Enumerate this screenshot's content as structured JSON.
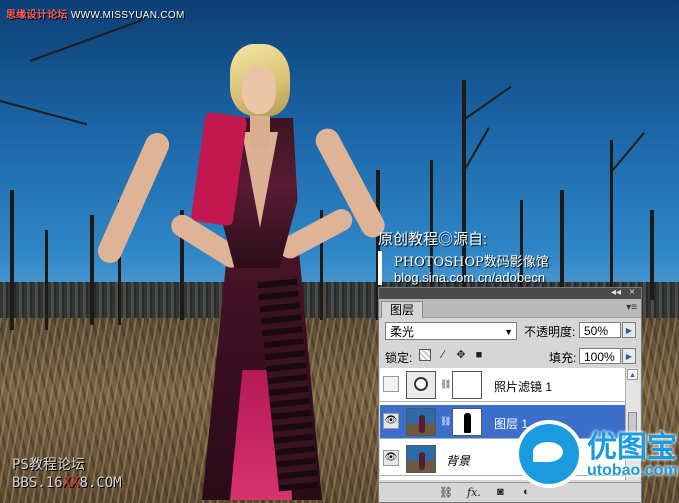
{
  "watermark_top": {
    "site_name": "思缘设计论坛",
    "site_url": "WWW.MISSYUAN.COM"
  },
  "credit": {
    "line1": "原创教程◎源自:",
    "line2": "PHOTOSHOP数码影像馆",
    "line3": "blog.sina.com.cn/adobecn"
  },
  "bbs": {
    "line1": "PS教程论坛",
    "line2_prefix": "BBS.16",
    "line2_red": "XX",
    "line2_suffix": "8.COM"
  },
  "brand": {
    "name": "优图宝",
    "url": "utobao.com"
  },
  "layers_panel": {
    "tab_label": "图层",
    "menu_glyph": "▾≡",
    "collapse_glyph": "◂◂",
    "close_glyph": "×",
    "blend_mode": "柔光",
    "opacity_label": "不透明度:",
    "opacity_value": "50%",
    "lock_label": "锁定:",
    "fill_label": "填充:",
    "fill_value": "100%",
    "layers": [
      {
        "name": "照片滤镜 1",
        "visible": false,
        "selected": false,
        "type": "adjustment"
      },
      {
        "name": "图层 1",
        "visible": true,
        "selected": true,
        "type": "pixel"
      },
      {
        "name": "背景",
        "visible": true,
        "selected": false,
        "type": "background"
      }
    ],
    "footer_icons": [
      "link-icon",
      "fx-icon",
      "mask-icon",
      "adjustment-icon"
    ]
  }
}
